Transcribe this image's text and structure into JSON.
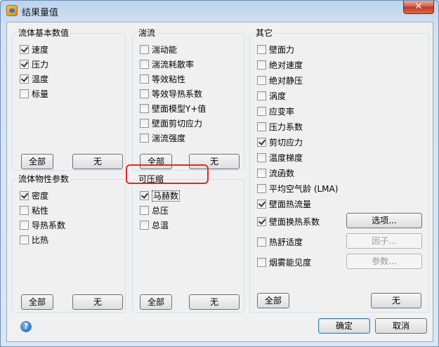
{
  "window": {
    "title": "结果量值",
    "close": "✕"
  },
  "groups": {
    "basic": {
      "title": "流体基本数值",
      "items": [
        {
          "label": "速度",
          "checked": true
        },
        {
          "label": "压力",
          "checked": true
        },
        {
          "label": "温度",
          "checked": true
        },
        {
          "label": "标量",
          "checked": false
        }
      ],
      "all_label": "全部",
      "none_label": "无"
    },
    "turbulence": {
      "title": "湍流",
      "items": [
        {
          "label": "湍动能",
          "checked": false
        },
        {
          "label": "湍流耗散率",
          "checked": false
        },
        {
          "label": "等效粘性",
          "checked": false
        },
        {
          "label": "等效导热系数",
          "checked": false
        },
        {
          "label": "壁面模型Y+值",
          "checked": false
        },
        {
          "label": "壁面剪切应力",
          "checked": false
        },
        {
          "label": "湍流强度",
          "checked": false
        }
      ],
      "all_label": "全部",
      "none_label": "无"
    },
    "other": {
      "title": "其它",
      "items": [
        {
          "label": "壁面力",
          "checked": false
        },
        {
          "label": "绝对速度",
          "checked": false
        },
        {
          "label": "绝对静压",
          "checked": false
        },
        {
          "label": "涡度",
          "checked": false
        },
        {
          "label": "应变率",
          "checked": false
        },
        {
          "label": "压力系数",
          "checked": false
        },
        {
          "label": "剪切应力",
          "checked": true
        },
        {
          "label": "温度梯度",
          "checked": false
        },
        {
          "label": "流函数",
          "checked": false
        },
        {
          "label": "平均空气龄 (LMA)",
          "checked": false
        },
        {
          "label": "壁面热流量",
          "checked": true
        },
        {
          "label": "壁面换热系数",
          "checked": true
        },
        {
          "label": "热舒适度",
          "checked": false
        },
        {
          "label": "烟雾能见度",
          "checked": false
        }
      ],
      "options_label": "选项...",
      "factor_label": "因子...",
      "params_label": "参数...",
      "all_label": "全部",
      "none_label": "无"
    },
    "properties": {
      "title": "流体物性参数",
      "items": [
        {
          "label": "密度",
          "checked": true
        },
        {
          "label": "粘性",
          "checked": false
        },
        {
          "label": "导热系数",
          "checked": false
        },
        {
          "label": "比热",
          "checked": false
        }
      ],
      "all_label": "全部",
      "none_label": "无"
    },
    "compressible": {
      "title": "可压缩",
      "items": [
        {
          "label": "马赫数",
          "checked": true
        },
        {
          "label": "总压",
          "checked": false
        },
        {
          "label": "总温",
          "checked": false
        }
      ],
      "all_label": "全部",
      "none_label": "无"
    }
  },
  "footer": {
    "ok_label": "确定",
    "cancel_label": "取消",
    "help": "?"
  }
}
